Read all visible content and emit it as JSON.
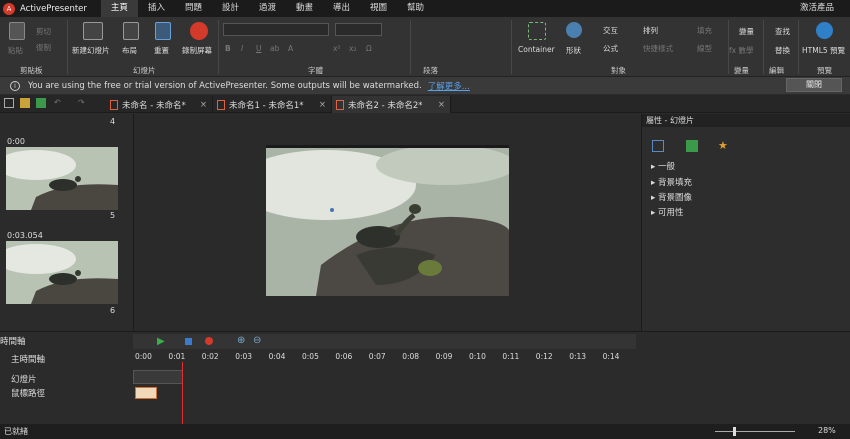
{
  "app": {
    "name": "ActivePresenter",
    "logo_char": "A"
  },
  "menu": {
    "items": [
      "主頁",
      "插入",
      "問題",
      "設計",
      "過渡",
      "動畫",
      "導出",
      "視圖",
      "幫助"
    ],
    "active": 0,
    "activate": "激活產品"
  },
  "ribbon": {
    "clipboard": {
      "paste": "粘貼",
      "cut": "剪切",
      "copy": "復制",
      "label": "剪貼板"
    },
    "slides": {
      "new_slide": "新建幻燈片",
      "layout": "布局",
      "reset": "重置",
      "record": "錄制屏幕",
      "label": "幻燈片"
    },
    "font": {
      "label": "字體",
      "format_chars": [
        "B",
        "I",
        "U",
        "ab",
        "A",
        "x²",
        "x₂",
        "Ω"
      ]
    },
    "paragraph": {
      "label": "段落"
    },
    "objects": {
      "container": "Container",
      "shape": "形狀",
      "interaction": "交互",
      "equation": "公式",
      "arrange": "排列",
      "quick_style": "快捷樣式",
      "fill": "填充",
      "outline": "線型",
      "label": "對象"
    },
    "variables": {
      "variable": "變量",
      "fx": "fx 數學",
      "label": "變量"
    },
    "editing": {
      "find": "查找",
      "replace": "替換",
      "label": "編輯"
    },
    "preview": {
      "html5": "HTML5 預覽",
      "label": "預覽"
    }
  },
  "notice": {
    "text": "You are using the free or trial version of ActivePresenter. Some outputs will be watermarked.",
    "link": "了解更多...",
    "close": "關閉"
  },
  "tabs": [
    {
      "title": "未命名 - 未命名*"
    },
    {
      "title": "未命名1 - 未命名1*"
    },
    {
      "title": "未命名2 - 未命名2*"
    }
  ],
  "slides_panel": {
    "slides": [
      {
        "number": "4",
        "duration": ""
      },
      {
        "number": "5",
        "duration": "0:00"
      },
      {
        "number": "6",
        "duration": "0:03.054"
      }
    ]
  },
  "properties": {
    "title": "屬性 - 幻燈片",
    "sections": [
      "一般",
      "背景填充",
      "背景圖像",
      "可用性"
    ]
  },
  "timeline": {
    "title": "時間軸",
    "main_track": "主時間軸",
    "tracks": [
      "幻燈片",
      "鼠標路徑"
    ],
    "ticks": [
      "0:00",
      "0:01",
      "0:02",
      "0:03",
      "0:04",
      "0:05",
      "0:06",
      "0:07",
      "0:08",
      "0:09",
      "0:10",
      "0:11",
      "0:12",
      "0:13",
      "0:14"
    ]
  },
  "status": {
    "text": "已就緒",
    "zoom": "28%"
  },
  "colors": {
    "accent": "#d43a2a",
    "playhead": "#e03030",
    "link": "#5aa0e6"
  }
}
